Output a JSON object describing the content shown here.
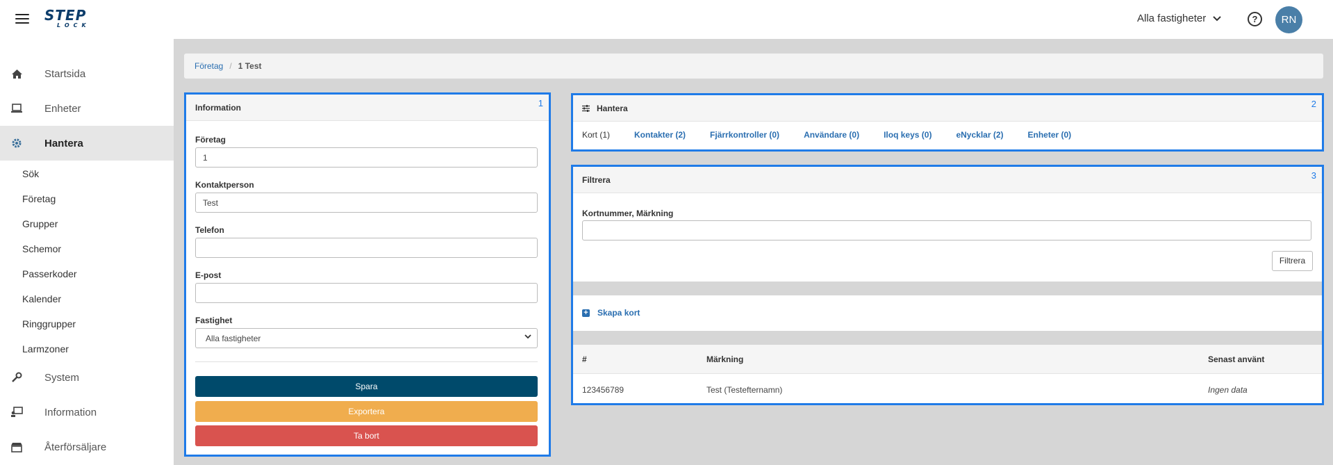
{
  "header": {
    "logo_top": "STEP",
    "logo_bottom": "LOCK",
    "property_select": "Alla fastigheter",
    "help": "?",
    "avatar_initials": "RN"
  },
  "sidebar": {
    "items": [
      {
        "label": "Startsida"
      },
      {
        "label": "Enheter"
      },
      {
        "label": "Hantera"
      },
      {
        "label": "System"
      },
      {
        "label": "Information"
      },
      {
        "label": "Återförsäljare"
      }
    ],
    "sub_items": [
      "Sök",
      "Företag",
      "Grupper",
      "Schemor",
      "Passerkoder",
      "Kalender",
      "Ringgrupper",
      "Larmzoner"
    ]
  },
  "breadcrumb": {
    "parent": "Företag",
    "separator": "/",
    "current": "1 Test"
  },
  "info_panel": {
    "title": "Information",
    "number": "1",
    "company_label": "Företag",
    "company_value": "1",
    "contact_label": "Kontaktperson",
    "contact_value": "Test",
    "phone_label": "Telefon",
    "phone_value": "",
    "email_label": "E-post",
    "email_value": "",
    "property_label": "Fastighet",
    "property_value": "Alla fastigheter",
    "save_label": "Spara",
    "export_label": "Exportera",
    "delete_label": "Ta bort",
    "colors": {
      "save": "#004a6b",
      "export": "#f0ad4e",
      "delete": "#d9534f"
    }
  },
  "manage_panel": {
    "title": "Hantera",
    "number": "2",
    "tabs": [
      {
        "label": "Kort (1)",
        "active": true
      },
      {
        "label": "Kontakter (2)",
        "active": false
      },
      {
        "label": "Fjärrkontroller (0)",
        "active": false
      },
      {
        "label": "Användare (0)",
        "active": false
      },
      {
        "label": "Iloq keys (0)",
        "active": false
      },
      {
        "label": "eNycklar (2)",
        "active": false
      },
      {
        "label": "Enheter (0)",
        "active": false
      }
    ]
  },
  "filter_panel": {
    "title": "Filtrera",
    "number": "3",
    "search_label": "Kortnummer, Märkning",
    "search_value": "",
    "filter_button": "Filtrera",
    "create_label": "Skapa kort",
    "table": {
      "headers": [
        "#",
        "Märkning",
        "Senast använt"
      ],
      "rows": [
        [
          "123456789",
          "Test (Testefternamn)",
          "Ingen data"
        ]
      ]
    }
  }
}
